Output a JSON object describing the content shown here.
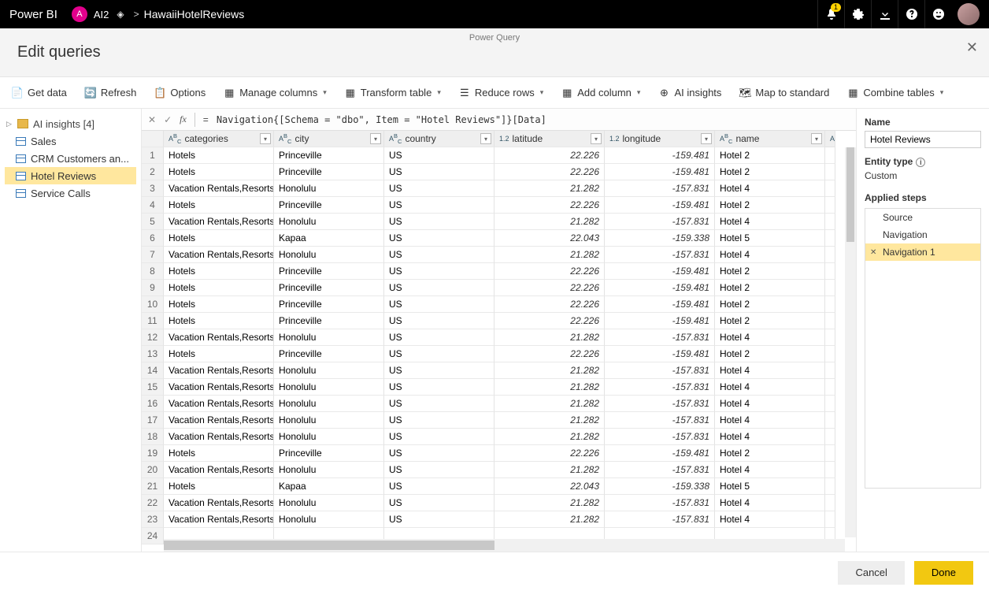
{
  "topbar": {
    "brand": "Power BI",
    "workspace_initial": "A",
    "workspace_name": "AI2",
    "breadcrumb_sep": ">",
    "dataset_name": "HawaiiHotelReviews",
    "notification_count": "1"
  },
  "modal": {
    "app_label": "Power Query",
    "title": "Edit queries"
  },
  "ribbon": {
    "get_data": "Get data",
    "refresh": "Refresh",
    "options": "Options",
    "manage_columns": "Manage columns",
    "transform_table": "Transform table",
    "reduce_rows": "Reduce rows",
    "add_column": "Add column",
    "ai_insights": "AI insights",
    "map_to_standard": "Map to standard",
    "combine_tables": "Combine tables"
  },
  "queries": {
    "group_label": "AI insights [4]",
    "items": [
      "Sales",
      "CRM Customers an...",
      "Hotel Reviews",
      "Service Calls"
    ],
    "selected_index": 2
  },
  "formula": {
    "equals": "=",
    "text": "Navigation{[Schema = \"dbo\", Item = \"Hotel Reviews\"]}[Data]"
  },
  "grid": {
    "columns": [
      {
        "type": "ABC",
        "name": "categories"
      },
      {
        "type": "ABC",
        "name": "city"
      },
      {
        "type": "ABC",
        "name": "country"
      },
      {
        "type": "1.2",
        "name": "latitude"
      },
      {
        "type": "1.2",
        "name": "longitude"
      },
      {
        "type": "ABC",
        "name": "name"
      }
    ],
    "rows": [
      {
        "n": 1,
        "categories": "Hotels",
        "city": "Princeville",
        "country": "US",
        "latitude": "22.226",
        "longitude": "-159.481",
        "name": "Hotel 2"
      },
      {
        "n": 2,
        "categories": "Hotels",
        "city": "Princeville",
        "country": "US",
        "latitude": "22.226",
        "longitude": "-159.481",
        "name": "Hotel 2"
      },
      {
        "n": 3,
        "categories": "Vacation Rentals,Resorts &...",
        "city": "Honolulu",
        "country": "US",
        "latitude": "21.282",
        "longitude": "-157.831",
        "name": "Hotel 4"
      },
      {
        "n": 4,
        "categories": "Hotels",
        "city": "Princeville",
        "country": "US",
        "latitude": "22.226",
        "longitude": "-159.481",
        "name": "Hotel 2"
      },
      {
        "n": 5,
        "categories": "Vacation Rentals,Resorts &...",
        "city": "Honolulu",
        "country": "US",
        "latitude": "21.282",
        "longitude": "-157.831",
        "name": "Hotel 4"
      },
      {
        "n": 6,
        "categories": "Hotels",
        "city": "Kapaa",
        "country": "US",
        "latitude": "22.043",
        "longitude": "-159.338",
        "name": "Hotel 5"
      },
      {
        "n": 7,
        "categories": "Vacation Rentals,Resorts &...",
        "city": "Honolulu",
        "country": "US",
        "latitude": "21.282",
        "longitude": "-157.831",
        "name": "Hotel 4"
      },
      {
        "n": 8,
        "categories": "Hotels",
        "city": "Princeville",
        "country": "US",
        "latitude": "22.226",
        "longitude": "-159.481",
        "name": "Hotel 2"
      },
      {
        "n": 9,
        "categories": "Hotels",
        "city": "Princeville",
        "country": "US",
        "latitude": "22.226",
        "longitude": "-159.481",
        "name": "Hotel 2"
      },
      {
        "n": 10,
        "categories": "Hotels",
        "city": "Princeville",
        "country": "US",
        "latitude": "22.226",
        "longitude": "-159.481",
        "name": "Hotel 2"
      },
      {
        "n": 11,
        "categories": "Hotels",
        "city": "Princeville",
        "country": "US",
        "latitude": "22.226",
        "longitude": "-159.481",
        "name": "Hotel 2"
      },
      {
        "n": 12,
        "categories": "Vacation Rentals,Resorts &...",
        "city": "Honolulu",
        "country": "US",
        "latitude": "21.282",
        "longitude": "-157.831",
        "name": "Hotel 4"
      },
      {
        "n": 13,
        "categories": "Hotels",
        "city": "Princeville",
        "country": "US",
        "latitude": "22.226",
        "longitude": "-159.481",
        "name": "Hotel 2"
      },
      {
        "n": 14,
        "categories": "Vacation Rentals,Resorts &...",
        "city": "Honolulu",
        "country": "US",
        "latitude": "21.282",
        "longitude": "-157.831",
        "name": "Hotel 4"
      },
      {
        "n": 15,
        "categories": "Vacation Rentals,Resorts &...",
        "city": "Honolulu",
        "country": "US",
        "latitude": "21.282",
        "longitude": "-157.831",
        "name": "Hotel 4"
      },
      {
        "n": 16,
        "categories": "Vacation Rentals,Resorts &...",
        "city": "Honolulu",
        "country": "US",
        "latitude": "21.282",
        "longitude": "-157.831",
        "name": "Hotel 4"
      },
      {
        "n": 17,
        "categories": "Vacation Rentals,Resorts &...",
        "city": "Honolulu",
        "country": "US",
        "latitude": "21.282",
        "longitude": "-157.831",
        "name": "Hotel 4"
      },
      {
        "n": 18,
        "categories": "Vacation Rentals,Resorts &...",
        "city": "Honolulu",
        "country": "US",
        "latitude": "21.282",
        "longitude": "-157.831",
        "name": "Hotel 4"
      },
      {
        "n": 19,
        "categories": "Hotels",
        "city": "Princeville",
        "country": "US",
        "latitude": "22.226",
        "longitude": "-159.481",
        "name": "Hotel 2"
      },
      {
        "n": 20,
        "categories": "Vacation Rentals,Resorts &...",
        "city": "Honolulu",
        "country": "US",
        "latitude": "21.282",
        "longitude": "-157.831",
        "name": "Hotel 4"
      },
      {
        "n": 21,
        "categories": "Hotels",
        "city": "Kapaa",
        "country": "US",
        "latitude": "22.043",
        "longitude": "-159.338",
        "name": "Hotel 5"
      },
      {
        "n": 22,
        "categories": "Vacation Rentals,Resorts &...",
        "city": "Honolulu",
        "country": "US",
        "latitude": "21.282",
        "longitude": "-157.831",
        "name": "Hotel 4"
      },
      {
        "n": 23,
        "categories": "Vacation Rentals,Resorts &...",
        "city": "Honolulu",
        "country": "US",
        "latitude": "21.282",
        "longitude": "-157.831",
        "name": "Hotel 4"
      },
      {
        "n": 24,
        "categories": "",
        "city": "",
        "country": "",
        "latitude": "",
        "longitude": "",
        "name": ""
      }
    ]
  },
  "right": {
    "name_label": "Name",
    "name_value": "Hotel Reviews",
    "entity_type_label": "Entity type",
    "entity_type_value": "Custom",
    "applied_steps_label": "Applied steps",
    "steps": [
      "Source",
      "Navigation",
      "Navigation 1"
    ],
    "selected_step_index": 2
  },
  "footer": {
    "cancel": "Cancel",
    "done": "Done"
  }
}
